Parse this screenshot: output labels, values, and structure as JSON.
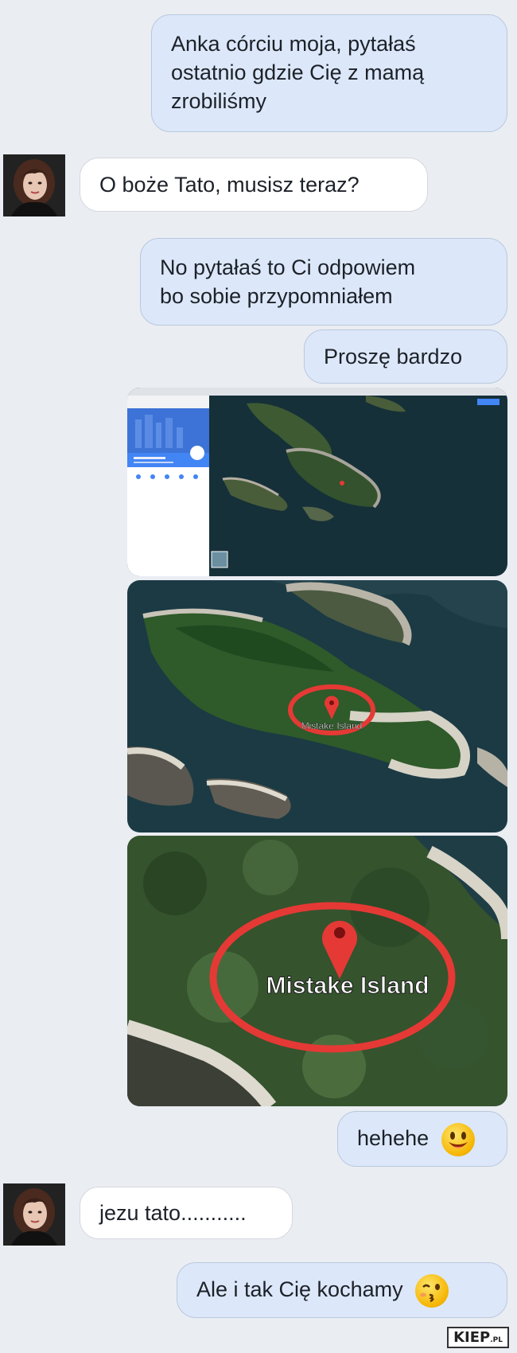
{
  "messages": [
    {
      "from": "me",
      "text_lines": [
        "Anka córciu moja, pytałaś",
        "ostatnio gdzie Cię z mamą",
        "zrobiliśmy"
      ]
    },
    {
      "from": "daughter",
      "text": "O boże Tato, musisz teraz?"
    },
    {
      "from": "me",
      "text_lines": [
        "No pytałaś to Ci odpowiem",
        "bo sobie przypomniałem"
      ]
    },
    {
      "from": "me",
      "text": "Proszę bardzo"
    },
    {
      "from": "me",
      "type": "images",
      "images": [
        {
          "kind": "map-screenshot"
        },
        {
          "kind": "satellite",
          "label": "Mistake Island"
        },
        {
          "kind": "satellite-zoom",
          "label": "Mistake Island"
        }
      ]
    },
    {
      "from": "me",
      "text": "hehehe",
      "emoji": "smiling-face-emoji"
    },
    {
      "from": "daughter",
      "text": "jezu tato..........."
    },
    {
      "from": "me",
      "text": "Ale i tak Cię kochamy",
      "emoji": "kissing-face-emoji"
    }
  ],
  "watermark": {
    "main": "KIEP",
    "suffix": ".PL"
  },
  "colors": {
    "outgoing_bubble": "#dce8f9",
    "incoming_bubble": "#ffffff",
    "background": "#eaedf2",
    "marker": "#e53935"
  }
}
